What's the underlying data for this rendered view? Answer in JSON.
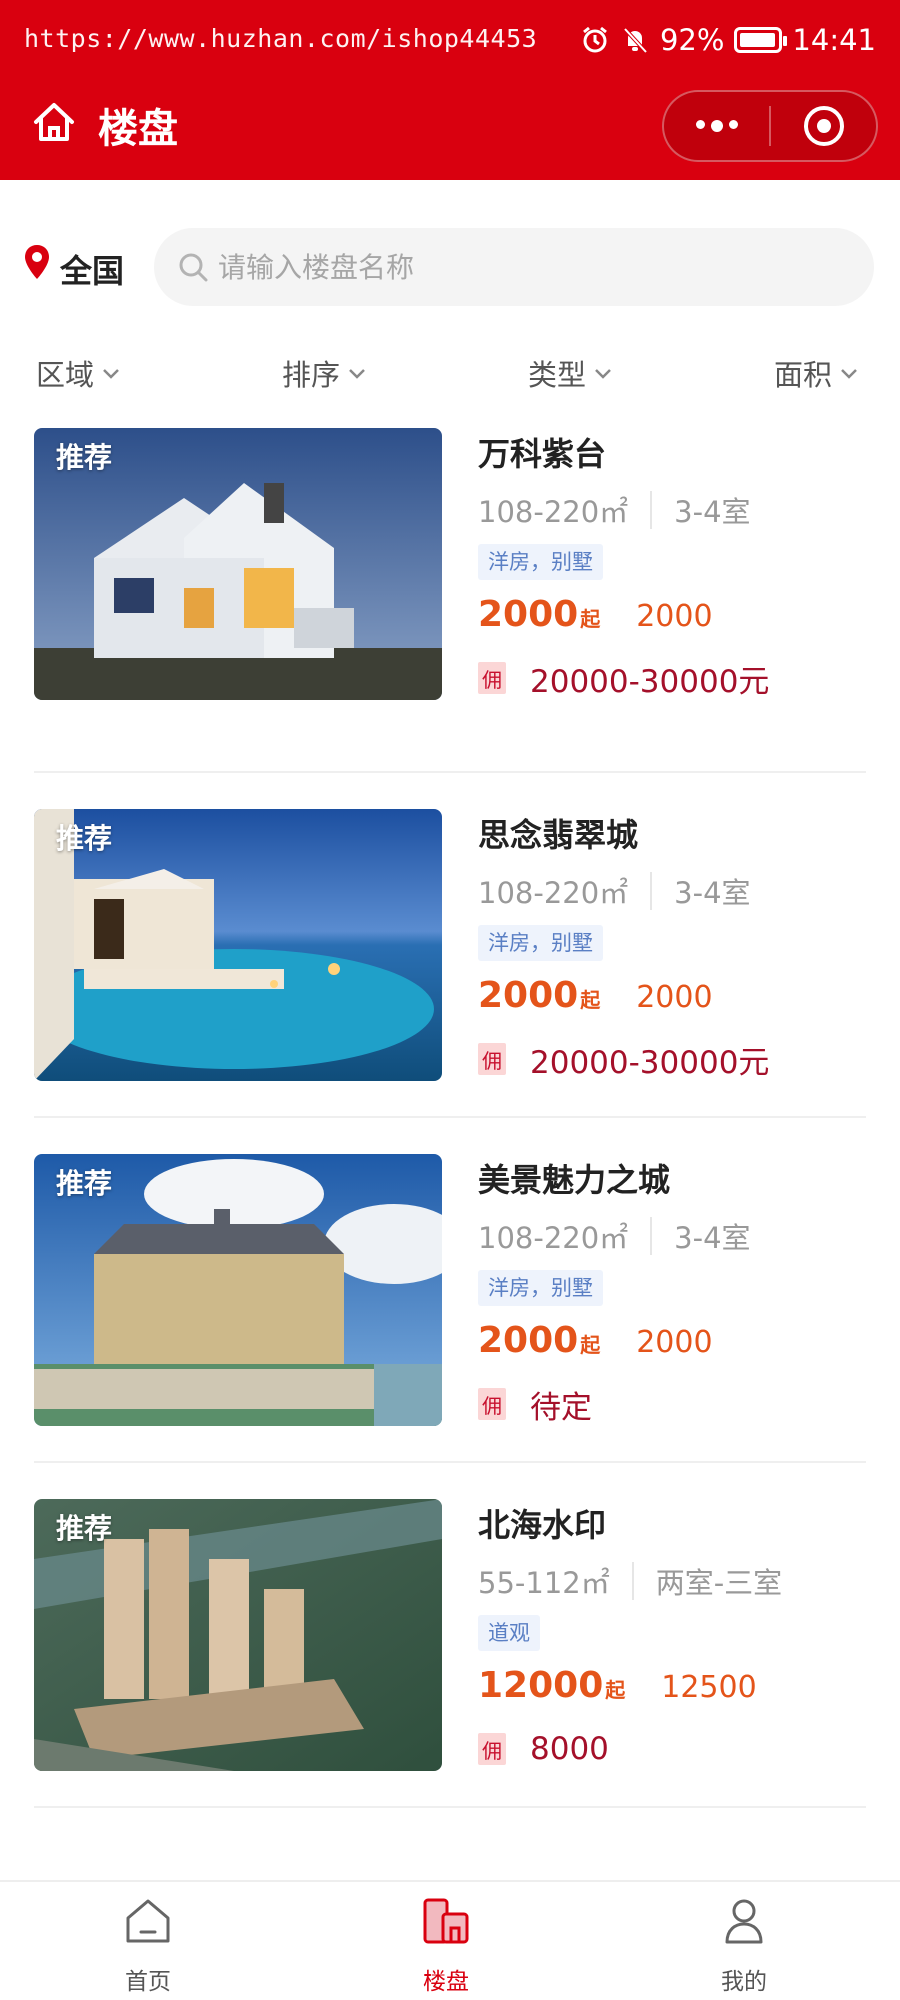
{
  "status_bar": {
    "url_text": "https://www.huzhan.com/ishop44453",
    "battery": "92%",
    "battery_level": 0.92,
    "time": "14:41",
    "icons": [
      "alarm-icon",
      "mute-icon",
      "battery-icon"
    ]
  },
  "header": {
    "title": "楼盘",
    "background_color": "#d9000f",
    "home_icon": "home-icon",
    "menu_icon": "more-dots-icon",
    "close_icon": "target-icon"
  },
  "search": {
    "location": "全国",
    "placeholder": "请输入楼盘名称",
    "value": ""
  },
  "filters": [
    {
      "label": "区域"
    },
    {
      "label": "排序"
    },
    {
      "label": "类型"
    },
    {
      "label": "面积"
    }
  ],
  "listings": [
    {
      "badge": "推荐",
      "name": "万科紫台",
      "area": "108-220㎡",
      "rooms": "3-4室",
      "tag": "洋房，别墅",
      "price": "2000",
      "price_unit": "起",
      "price2": "2000",
      "commission_label": "佣",
      "commission": "20000-30000元"
    },
    {
      "badge": "推荐",
      "name": "思念翡翠城",
      "area": "108-220㎡",
      "rooms": "3-4室",
      "tag": "洋房，别墅",
      "price": "2000",
      "price_unit": "起",
      "price2": "2000",
      "commission_label": "佣",
      "commission": "20000-30000元"
    },
    {
      "badge": "推荐",
      "name": "美景魅力之城",
      "area": "108-220㎡",
      "rooms": "3-4室",
      "tag": "洋房，别墅",
      "price": "2000",
      "price_unit": "起",
      "price2": "2000",
      "commission_label": "佣",
      "commission": "待定"
    },
    {
      "badge": "推荐",
      "name": "北海水印",
      "area": "55-112㎡",
      "rooms": "两室-三室",
      "tag": "道观",
      "price": "12000",
      "price_unit": "起",
      "price2": "12500",
      "commission_label": "佣",
      "commission": "8000"
    }
  ],
  "tabbar": [
    {
      "label": "首页",
      "icon": "home-tab-icon",
      "active": false
    },
    {
      "label": "楼盘",
      "icon": "building-tab-icon",
      "active": true
    },
    {
      "label": "我的",
      "icon": "user-tab-icon",
      "active": false
    }
  ],
  "colors": {
    "brand": "#d9000f",
    "price": "#e4541a",
    "commission": "#a4102a",
    "tag_text": "#5a7fc4"
  }
}
